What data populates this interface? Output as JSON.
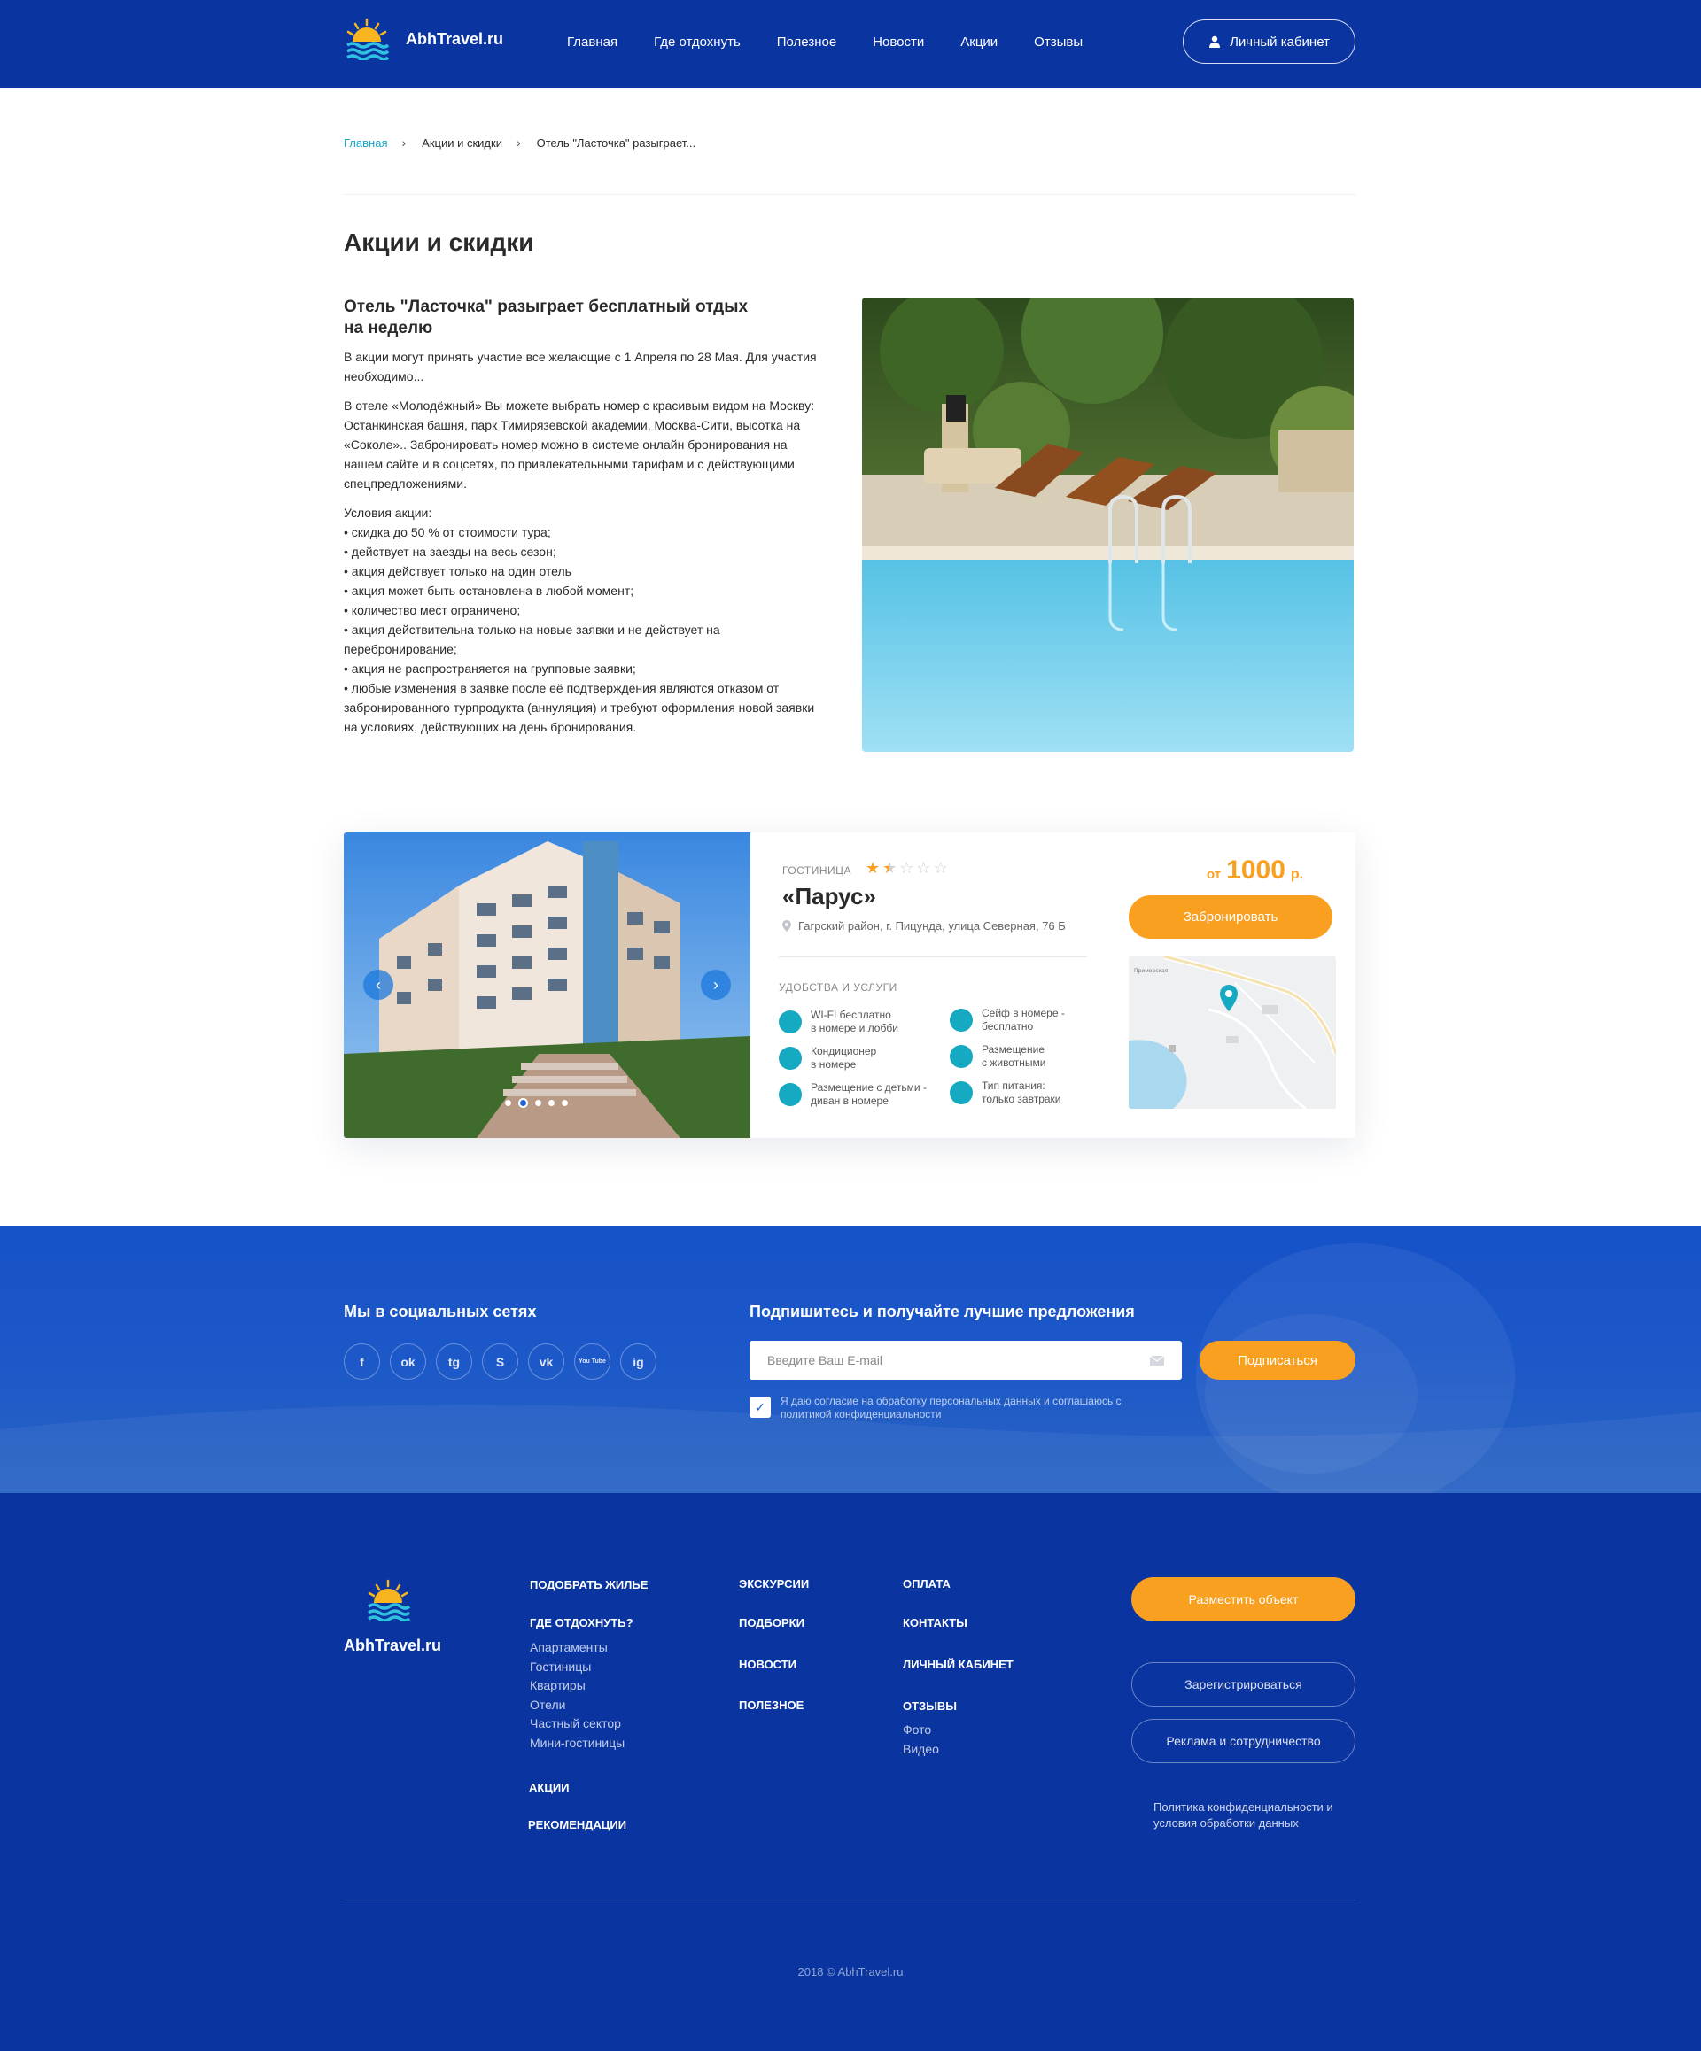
{
  "header": {
    "site_name": "AbhTravel.ru",
    "nav": [
      "Главная",
      "Где отдохнуть",
      "Полезное",
      "Новости",
      "Акции",
      "Отзывы"
    ],
    "cabinet": "Личный кабинет"
  },
  "breadcrumbs": {
    "home": "Главная",
    "section": "Акции и скидки",
    "current": "Отель \"Ласточка\" разыгрaет..."
  },
  "page_title": "Акции и скидки",
  "article": {
    "title": "Отель \"Ласточка\" разыграет бесплатный отдых на неделю",
    "intro": "В акции могут принять участие все желающие с 1 Апреля по 28 Мая. Для участия необходимо...",
    "body": "В отеле «Молодёжный» Вы можете выбрать номер с красивым видом на Москву: Останкинская башня, парк Тимирязевской академии, Москва-Сити, высотка на «Соколе».. Забронировать номер можно в системе онлайн бронирования на нашем сайте и в соцсетях, по привлекательными тарифам и с действующими спецпредложениями.",
    "conditions_title": "Условия акции:",
    "conditions": [
      "• скидка до 50 % от стоимости тура;",
      "• действует на заезды на весь сезон;",
      "• акция действует только на один отель",
      "• акция может быть остановлена в любой момент;",
      "• количество мест ограничено;",
      "• акция действительна только на новые заявки и не действует на перебронирование;",
      "• акция не распространяется на групповые заявки;",
      "• любые изменения в заявке после её подтверждения являются отказом от забронированного турпродукта (аннуляция) и требуют оформления новой заявки на условиях, действующих на день бронирования."
    ]
  },
  "hotel": {
    "type": "ГОСТИНИЦА",
    "rating": 1.5,
    "rating_max": 5,
    "name": "«Парус»",
    "address": "Гагрский район, г. Пицунда, улица Северная, 76 Б",
    "amenities_title": "УДОБСТВА И УСЛУГИ",
    "amenities": [
      {
        "line1": "WI-FI бесплатно",
        "line2": "в номере и лобби"
      },
      {
        "line1": "Кондиционер",
        "line2": "в номере"
      },
      {
        "line1": "Размещение с детьми -",
        "line2": "диван в номере"
      },
      {
        "line1": "Сейф в номере -",
        "line2": "бесплатно"
      },
      {
        "line1": "Размещение",
        "line2": "с животными"
      },
      {
        "line1": "Тип питания:",
        "line2": "только завтраки"
      }
    ],
    "price_from": "от",
    "price": "1000",
    "currency": "р.",
    "book": "Забронировать",
    "slides_total": 5,
    "slide_active": 2,
    "map_street": "Приморская"
  },
  "subscribe": {
    "social_title": "Мы в социальных сетях",
    "social": [
      "f",
      "ok",
      "tg",
      "S",
      "vk",
      "You Tube",
      "ig"
    ],
    "title": "Подпишитесь и получайте лучшие предложения",
    "email_placeholder": "Введите Ваш E-mail",
    "button": "Подписаться",
    "consent": "Я даю согласие на обработку персональных данных и соглашаюсь с политикой конфиденциальности"
  },
  "footer": {
    "site_name": "AbhTravel.ru",
    "col1_h1": "ПОДОБРАТЬ ЖИЛЬЕ",
    "col1_h2": "ГДЕ ОТДОХНУТЬ?",
    "col1_links": [
      "Апартаменты",
      "Гостиницы",
      "Квартиры",
      "Отели",
      "Частный сектор",
      "Мини-гостиницы"
    ],
    "col1_h3": "АКЦИИ",
    "col1_h4": "РЕКОМЕНДАЦИИ",
    "col2": [
      "ЭКСКУРСИИ",
      "ПОДБОРКИ",
      "НОВОСТИ",
      "ПОЛЕЗНОЕ"
    ],
    "col3": [
      "ОПЛАТА",
      "КОНТАКТЫ",
      "ЛИЧНЫЙ КАБИНЕТ",
      "ОТЗЫВЫ"
    ],
    "col3_links": [
      "Фото",
      "Видео"
    ],
    "btn_place": "Разместить объект",
    "btn_register": "Зарегистрироваться",
    "btn_ads": "Реклама и сотрудничество",
    "policy": "Политика конфиденциальности и условия обработки данных",
    "copyright": "2018 © AbhTravel.ru"
  },
  "colors": {
    "brand": "#0a34a0",
    "accent": "#f9a020",
    "teal": "#15aac1"
  }
}
